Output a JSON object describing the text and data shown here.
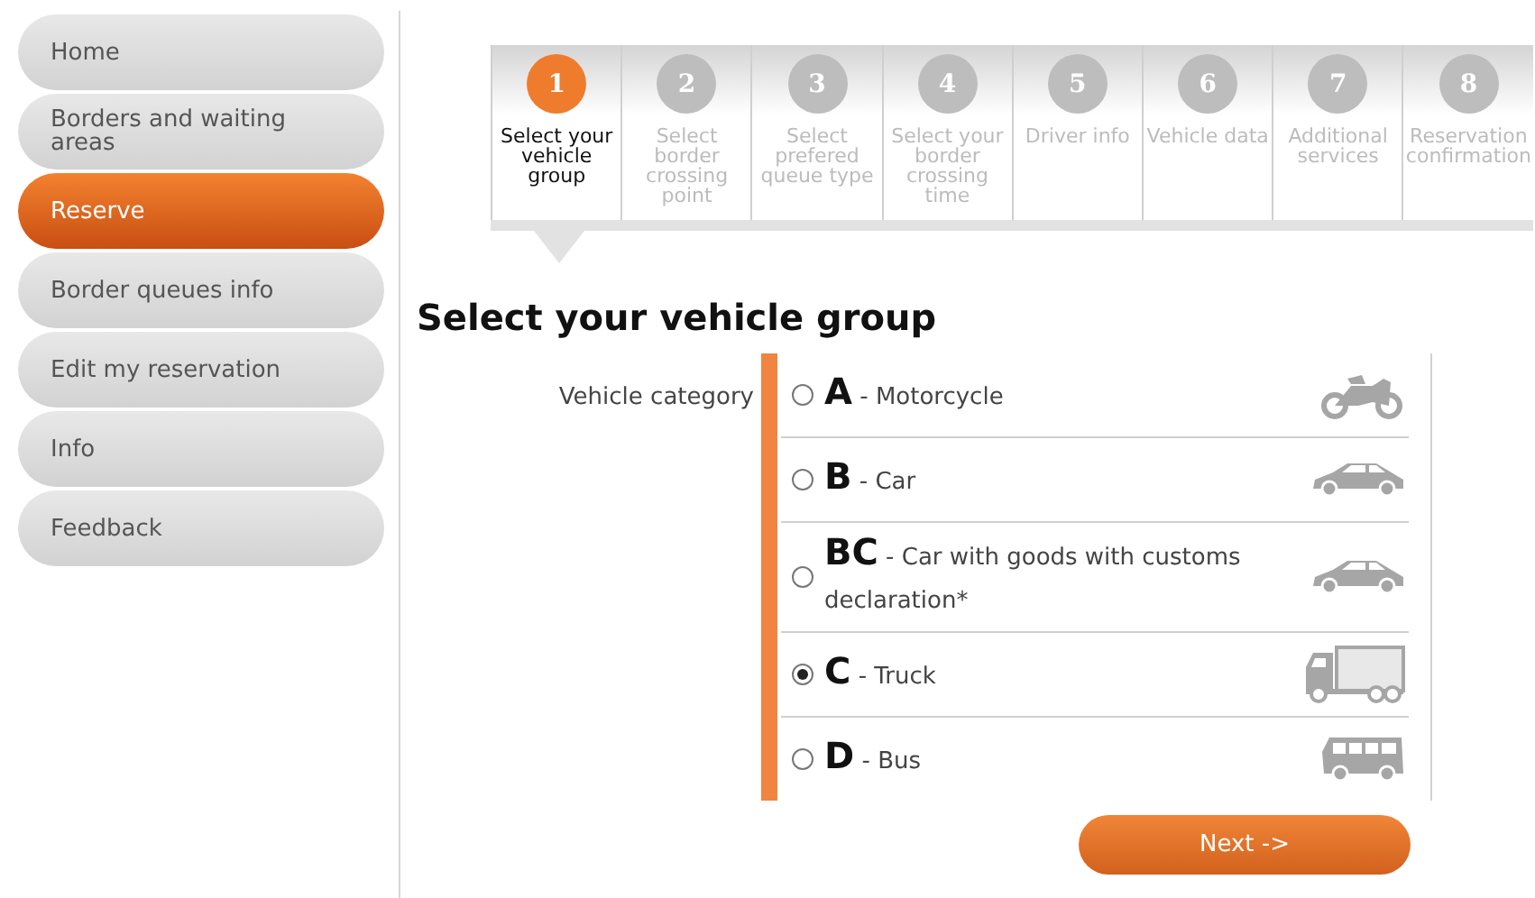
{
  "sidebar": {
    "items": [
      {
        "label": "Home",
        "selected": false
      },
      {
        "label": "Borders and waiting areas",
        "selected": false
      },
      {
        "label": "Reserve",
        "selected": true
      },
      {
        "label": "Border queues info",
        "selected": false
      },
      {
        "label": "Edit my reservation",
        "selected": false
      },
      {
        "label": "Info",
        "selected": false
      },
      {
        "label": "Feedback",
        "selected": false
      }
    ]
  },
  "steps": [
    {
      "number": "1",
      "label": "Select your vehicle group",
      "selected": true
    },
    {
      "number": "2",
      "label": "Select border crossing point",
      "selected": false
    },
    {
      "number": "3",
      "label": "Select prefered queue type",
      "selected": false
    },
    {
      "number": "4",
      "label": "Select your border crossing time",
      "selected": false
    },
    {
      "number": "5",
      "label": "Driver info",
      "selected": false
    },
    {
      "number": "6",
      "label": "Vehicle data",
      "selected": false
    },
    {
      "number": "7",
      "label": "Additional services",
      "selected": false
    },
    {
      "number": "8",
      "label": "Reservation confirmation",
      "selected": false
    }
  ],
  "heading": "Select your vehicle group",
  "form": {
    "label": "Vehicle category",
    "options": [
      {
        "code": "A",
        "description": "- Motorcycle",
        "kind": "motorcycle",
        "selected": false
      },
      {
        "code": "B",
        "description": "- Car",
        "kind": "car",
        "selected": false
      },
      {
        "code": "BC",
        "description": "- Car with goods with customs declaration*",
        "kind": "car",
        "selected": false
      },
      {
        "code": "C",
        "description": "- Truck",
        "kind": "truck",
        "selected": true
      },
      {
        "code": "D",
        "description": "- Bus",
        "kind": "bus",
        "selected": false
      }
    ]
  },
  "next_button": "Next ->"
}
